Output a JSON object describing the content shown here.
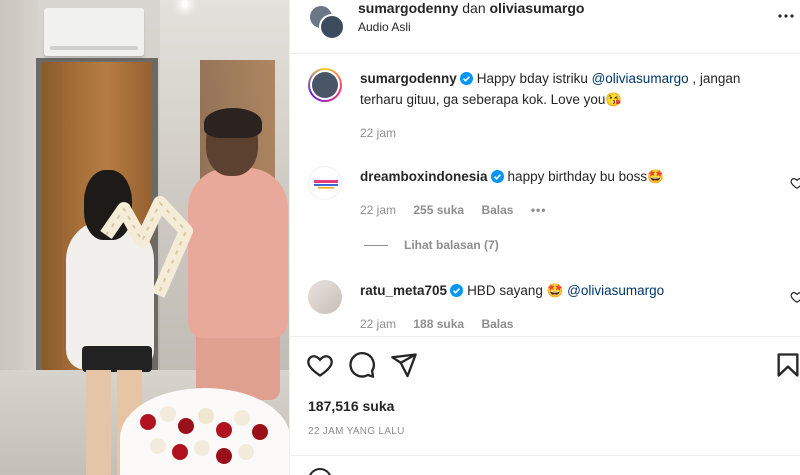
{
  "post": {
    "header": {
      "user1": "sumargodenny",
      "connector": "dan",
      "user2": "oliviasumargo",
      "audio": "Audio Asli"
    },
    "caption": {
      "user": "sumargodenny",
      "text_before": "Happy bday istriku ",
      "mention": "@oliviasumargo",
      "text_after": " , jangan terharu gituu​, ga seberapa kok. Love you😘",
      "time": "22 jam"
    },
    "comments": [
      {
        "user": "dreamboxindonesia",
        "text": "happy birthday bu boss🤩",
        "time": "22 jam",
        "likes": "255 suka",
        "reply": "Balas",
        "more": "•••",
        "view_replies": "Lihat balasan (7)"
      },
      {
        "user": "ratu_meta705",
        "text": "HBD sayang 🤩 ",
        "mention": "@oliviasumargo",
        "time": "22 jam",
        "likes": "188 suka",
        "reply": "Balas"
      }
    ],
    "likes": "187,516 suka",
    "posted": "22 JAM YANG LALU"
  },
  "icons": {
    "more": "more-options-icon",
    "heart": "heart-icon",
    "comment": "comment-icon",
    "share": "share-icon",
    "save": "bookmark-icon",
    "verified": "verified-badge-icon"
  },
  "colors": {
    "text": "#262626",
    "muted": "#8e8e8e",
    "verified": "#0095f6",
    "mention": "#00376b"
  }
}
